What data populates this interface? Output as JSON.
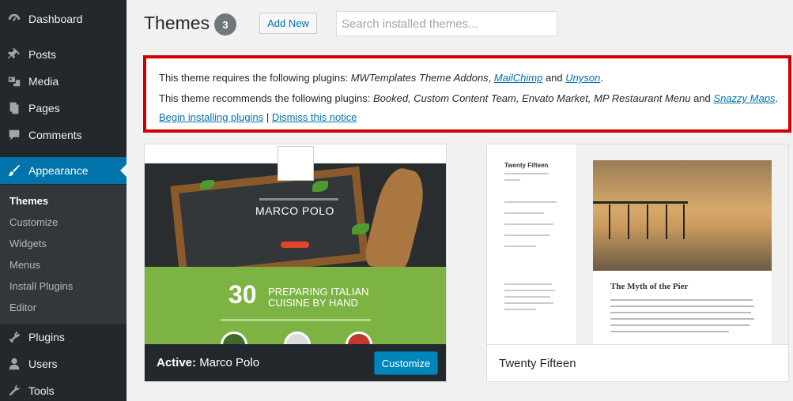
{
  "sidebar": {
    "items": [
      {
        "label": "Dashboard",
        "icon": "dashboard-icon"
      },
      {
        "label": "Posts",
        "icon": "pin-icon"
      },
      {
        "label": "Media",
        "icon": "media-icon"
      },
      {
        "label": "Pages",
        "icon": "pages-icon"
      },
      {
        "label": "Comments",
        "icon": "comment-icon"
      },
      {
        "label": "Appearance",
        "icon": "brush-icon",
        "current": true
      },
      {
        "label": "Plugins",
        "icon": "plug-icon"
      },
      {
        "label": "Users",
        "icon": "user-icon"
      },
      {
        "label": "Tools",
        "icon": "wrench-icon"
      }
    ],
    "submenu": [
      "Themes",
      "Customize",
      "Widgets",
      "Menus",
      "Install Plugins",
      "Editor"
    ],
    "colors": {
      "background": "#23282d",
      "current": "#0073aa",
      "submenu": "#32373c"
    }
  },
  "header": {
    "title": "Themes",
    "count": "3",
    "add_new": "Add New",
    "search_placeholder": "Search installed themes..."
  },
  "notice": {
    "line1_prefix": "This theme requires the following plugins: ",
    "line1_plain": "MWTemplates Theme Addons",
    "line1_sep": ", ",
    "line1_link1": "MailChimp",
    "line1_and": " and ",
    "line1_link2": "Unyson",
    "line1_end": ".",
    "line2_prefix": "This theme recommends the following plugins: ",
    "line2_plain": "Booked, Custom Content Team, Envato Market, MP Restaurant Menu",
    "line2_and": " and ",
    "line2_link": "Snazzy Maps",
    "line2_end": ".",
    "action_install": "Begin installing plugins",
    "action_sep": " | ",
    "action_dismiss": "Dismiss this notice",
    "border_color": "#d00000"
  },
  "themes": [
    {
      "active_prefix": "Active:",
      "name": "Marco Polo",
      "action": "Customize",
      "screenshot": {
        "hero_title": "MARCO POLO",
        "number": "30",
        "headline_1": "PREPARING ITALIAN",
        "headline_2": "CUISINE BY HAND"
      }
    },
    {
      "name": "Twenty Fifteen",
      "screenshot": {
        "site_title": "Twenty Fifteen",
        "post_title": "The Myth of the Pier"
      }
    }
  ]
}
